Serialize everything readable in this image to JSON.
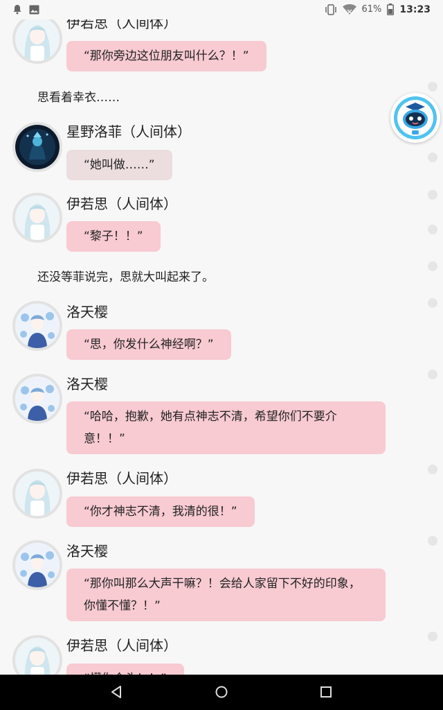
{
  "status_bar": {
    "battery": "61%",
    "time": "13:23"
  },
  "messages": [
    {
      "speaker": "伊若思（人间体）",
      "text": "“那你旁边这位朋友叫什么？！”"
    },
    {
      "narration": "思看着幸衣……"
    },
    {
      "speaker": "星野洛菲（人间体）",
      "text": "“她叫做……”"
    },
    {
      "speaker": "伊若思（人间体）",
      "text": "“黎子！！”"
    },
    {
      "narration": "还没等菲说完，思就大叫起来了。"
    },
    {
      "speaker": "洛天樱",
      "text": "“思，你发什么神经啊？”"
    },
    {
      "speaker": "洛天樱",
      "text": "“哈哈，抱歉，她有点神志不清，希望你们不要介意！！”"
    },
    {
      "speaker": "伊若思（人间体）",
      "text": "“你才神志不清，我清的很！”"
    },
    {
      "speaker": "洛天樱",
      "text": "“那你叫那么大声干嘛？！会给人家留下不好的印象，你懂不懂？！”"
    },
    {
      "speaker": "伊若思（人间体）",
      "text": "“懂你个头！！”"
    }
  ],
  "icons": {
    "status_left": [
      "notification-bell-icon",
      "gallery-icon"
    ],
    "status_right": [
      "vibrate-icon",
      "wifi-icon",
      "battery-icon"
    ],
    "assistant": "robot-assistant-icon",
    "nav": [
      "back-icon",
      "home-icon",
      "recents-icon"
    ]
  },
  "colors": {
    "bubble": "#f8cad2",
    "bubble_alt": "#ecdede",
    "background": "#f7f7f7"
  }
}
